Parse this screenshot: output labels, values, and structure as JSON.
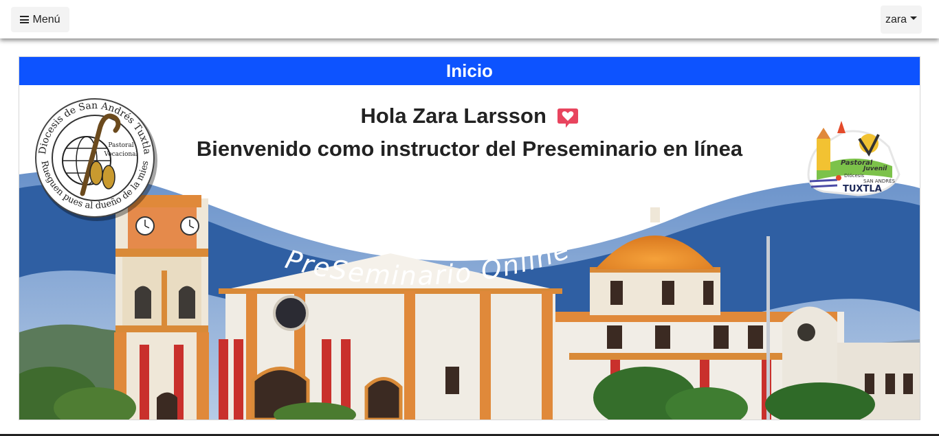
{
  "navbar": {
    "menu_label": "Menú",
    "user_label": "zara"
  },
  "card": {
    "header_title": "Inicio"
  },
  "banner": {
    "greeting": "Hola Zara Larsson",
    "welcome": "Bienvenido como instructor del Preseminario en línea",
    "wave_text": "PreSeminario Online",
    "left_logo_arc_top": "Diocesis de San Andrés Tuxtla",
    "left_logo_arc_bottom": "Rueguen pues al dueño de la mies",
    "left_logo_inner_1": "Pastoral",
    "left_logo_inner_2": "Vocacional",
    "right_logo_text_1": "Pastoral",
    "right_logo_text_2": "Juvenil",
    "right_logo_text_3": "Diócesis",
    "right_logo_text_4": "SAN ANDRÉS",
    "right_logo_text_5": "TUXTLA"
  },
  "colors": {
    "header_blue": "#0d53ff",
    "wave_blue": "#2f5fa3",
    "heart_pink": "#e8445e"
  },
  "icons": [
    "bars-icon",
    "caret-down-icon",
    "heart-message-icon"
  ]
}
